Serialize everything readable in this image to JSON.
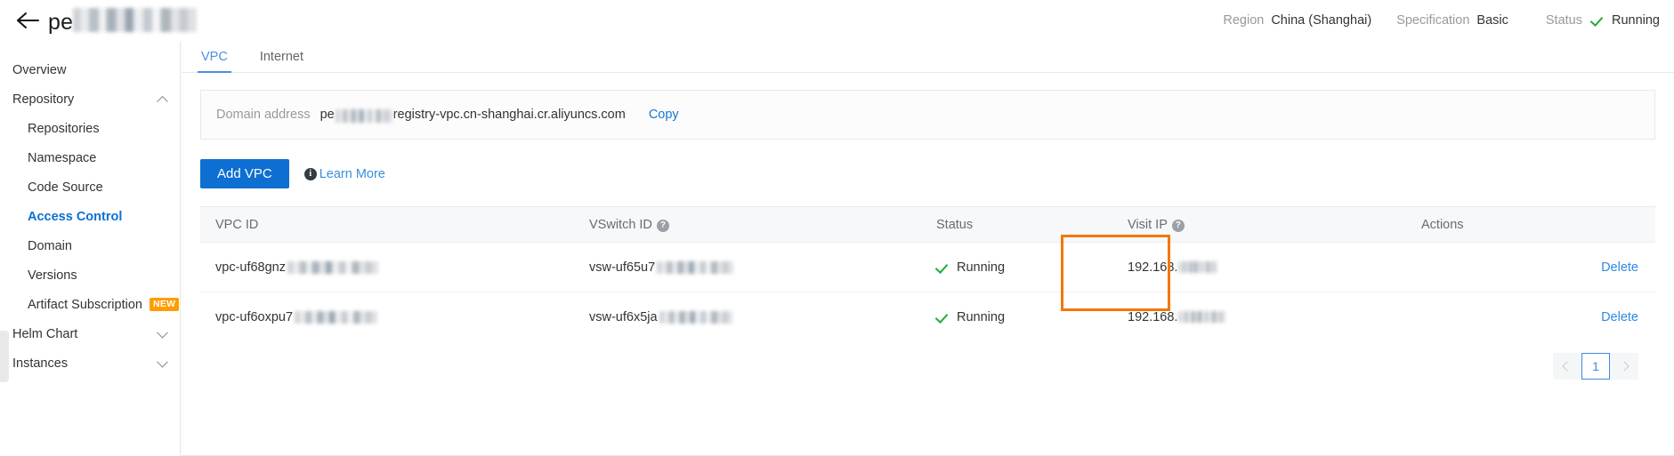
{
  "header": {
    "back_icon": "back-arrow-icon",
    "title_prefix": "pe",
    "title_redacted": true,
    "region_label": "Region",
    "region_value": "China (Shanghai)",
    "specification_label": "Specification",
    "specification_value": "Basic",
    "status_label": "Status",
    "status_value": "Running",
    "status_icon": "check-icon",
    "status_color": "#22ac38"
  },
  "sidebar": {
    "items": [
      {
        "label": "Overview",
        "level": "top",
        "active": false,
        "expandable": false
      },
      {
        "label": "Repository",
        "level": "top",
        "active": false,
        "expandable": true,
        "chevron": "up"
      },
      {
        "label": "Repositories",
        "level": "sub",
        "active": false
      },
      {
        "label": "Namespace",
        "level": "sub",
        "active": false
      },
      {
        "label": "Code Source",
        "level": "sub",
        "active": false
      },
      {
        "label": "Access Control",
        "level": "sub",
        "active": true
      },
      {
        "label": "Domain",
        "level": "sub",
        "active": false
      },
      {
        "label": "Versions",
        "level": "sub",
        "active": false
      },
      {
        "label": "Artifact Subscription",
        "level": "sub",
        "active": false,
        "badge": "NEW"
      },
      {
        "label": "Helm Chart",
        "level": "top",
        "active": false,
        "expandable": true,
        "chevron": "down"
      },
      {
        "label": "Instances",
        "level": "top",
        "active": false,
        "expandable": true,
        "chevron": "down"
      }
    ],
    "badge_color": "#ff9d00",
    "active_color": "#0b70d2"
  },
  "tabs": [
    {
      "label": "VPC",
      "active": true
    },
    {
      "label": "Internet",
      "active": false
    }
  ],
  "domain": {
    "label": "Domain address",
    "value_prefix": "pe",
    "value_suffix": "registry-vpc.cn-shanghai.cr.aliyuncs.com",
    "copy_label": "Copy"
  },
  "toolbar": {
    "add_vpc_label": "Add VPC",
    "learn_more_label": "Learn More",
    "info_icon": "info-icon",
    "primary_color": "#0d6fd1"
  },
  "table": {
    "columns": [
      {
        "label": "VPC ID",
        "help": false
      },
      {
        "label": "VSwitch ID",
        "help": true
      },
      {
        "label": "Status",
        "help": false
      },
      {
        "label": "Visit IP",
        "help": true
      },
      {
        "label": "Actions",
        "help": false
      }
    ],
    "rows": [
      {
        "vpc_id": "vpc-uf68gnz",
        "vswitch_id": "vsw-uf65u7",
        "status": "Running",
        "visit_ip": "192.168.",
        "action": "Delete"
      },
      {
        "vpc_id": "vpc-uf6oxpu7",
        "vswitch_id": "vsw-uf6x5ja",
        "status": "Running",
        "visit_ip": "192.168.",
        "action": "Delete"
      }
    ]
  },
  "highlight": {
    "target": "visit-ip-column",
    "color": "#f57600"
  },
  "pagination": {
    "prev_icon": "chevron-left-icon",
    "next_icon": "chevron-right-icon",
    "current_page": "1"
  }
}
